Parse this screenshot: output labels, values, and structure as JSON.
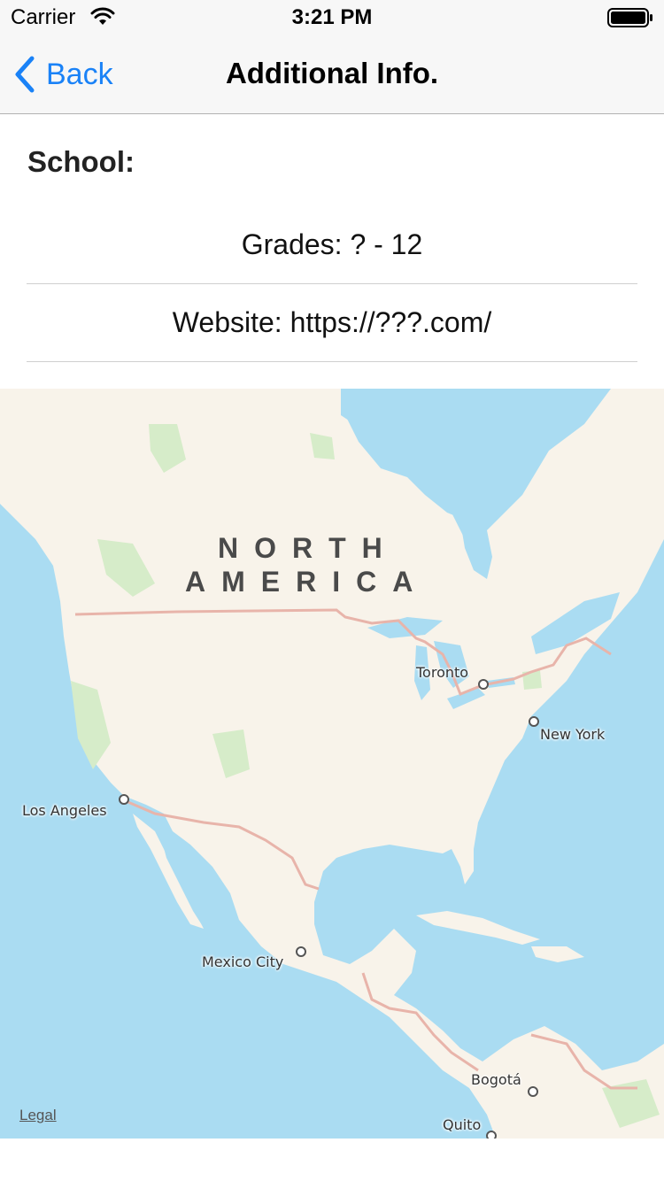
{
  "status_bar": {
    "carrier": "Carrier",
    "time": "3:21 PM",
    "wifi_icon": "wifi-icon",
    "battery_icon": "battery-icon"
  },
  "nav": {
    "back_label": "Back",
    "title": "Additional Info.",
    "back_icon": "chevron-left-icon"
  },
  "school": {
    "label": "School:"
  },
  "rows": {
    "grades": "Grades: ? - 12",
    "website": "Website: https://???.com/"
  },
  "map": {
    "region_line1": "NORTH",
    "region_line2": "AMERICA",
    "cities": [
      "Toronto",
      "New York",
      "Los Angeles",
      "Mexico City",
      "Bogotá",
      "Quito"
    ],
    "legal": "Legal",
    "colors": {
      "water": "#aadcf2",
      "land": "#f8f3ea",
      "park": "#d6ecc9",
      "border": "#e8b4aa"
    }
  },
  "colors": {
    "accent": "#1a82f7",
    "nav_background": "#f7f7f7"
  }
}
